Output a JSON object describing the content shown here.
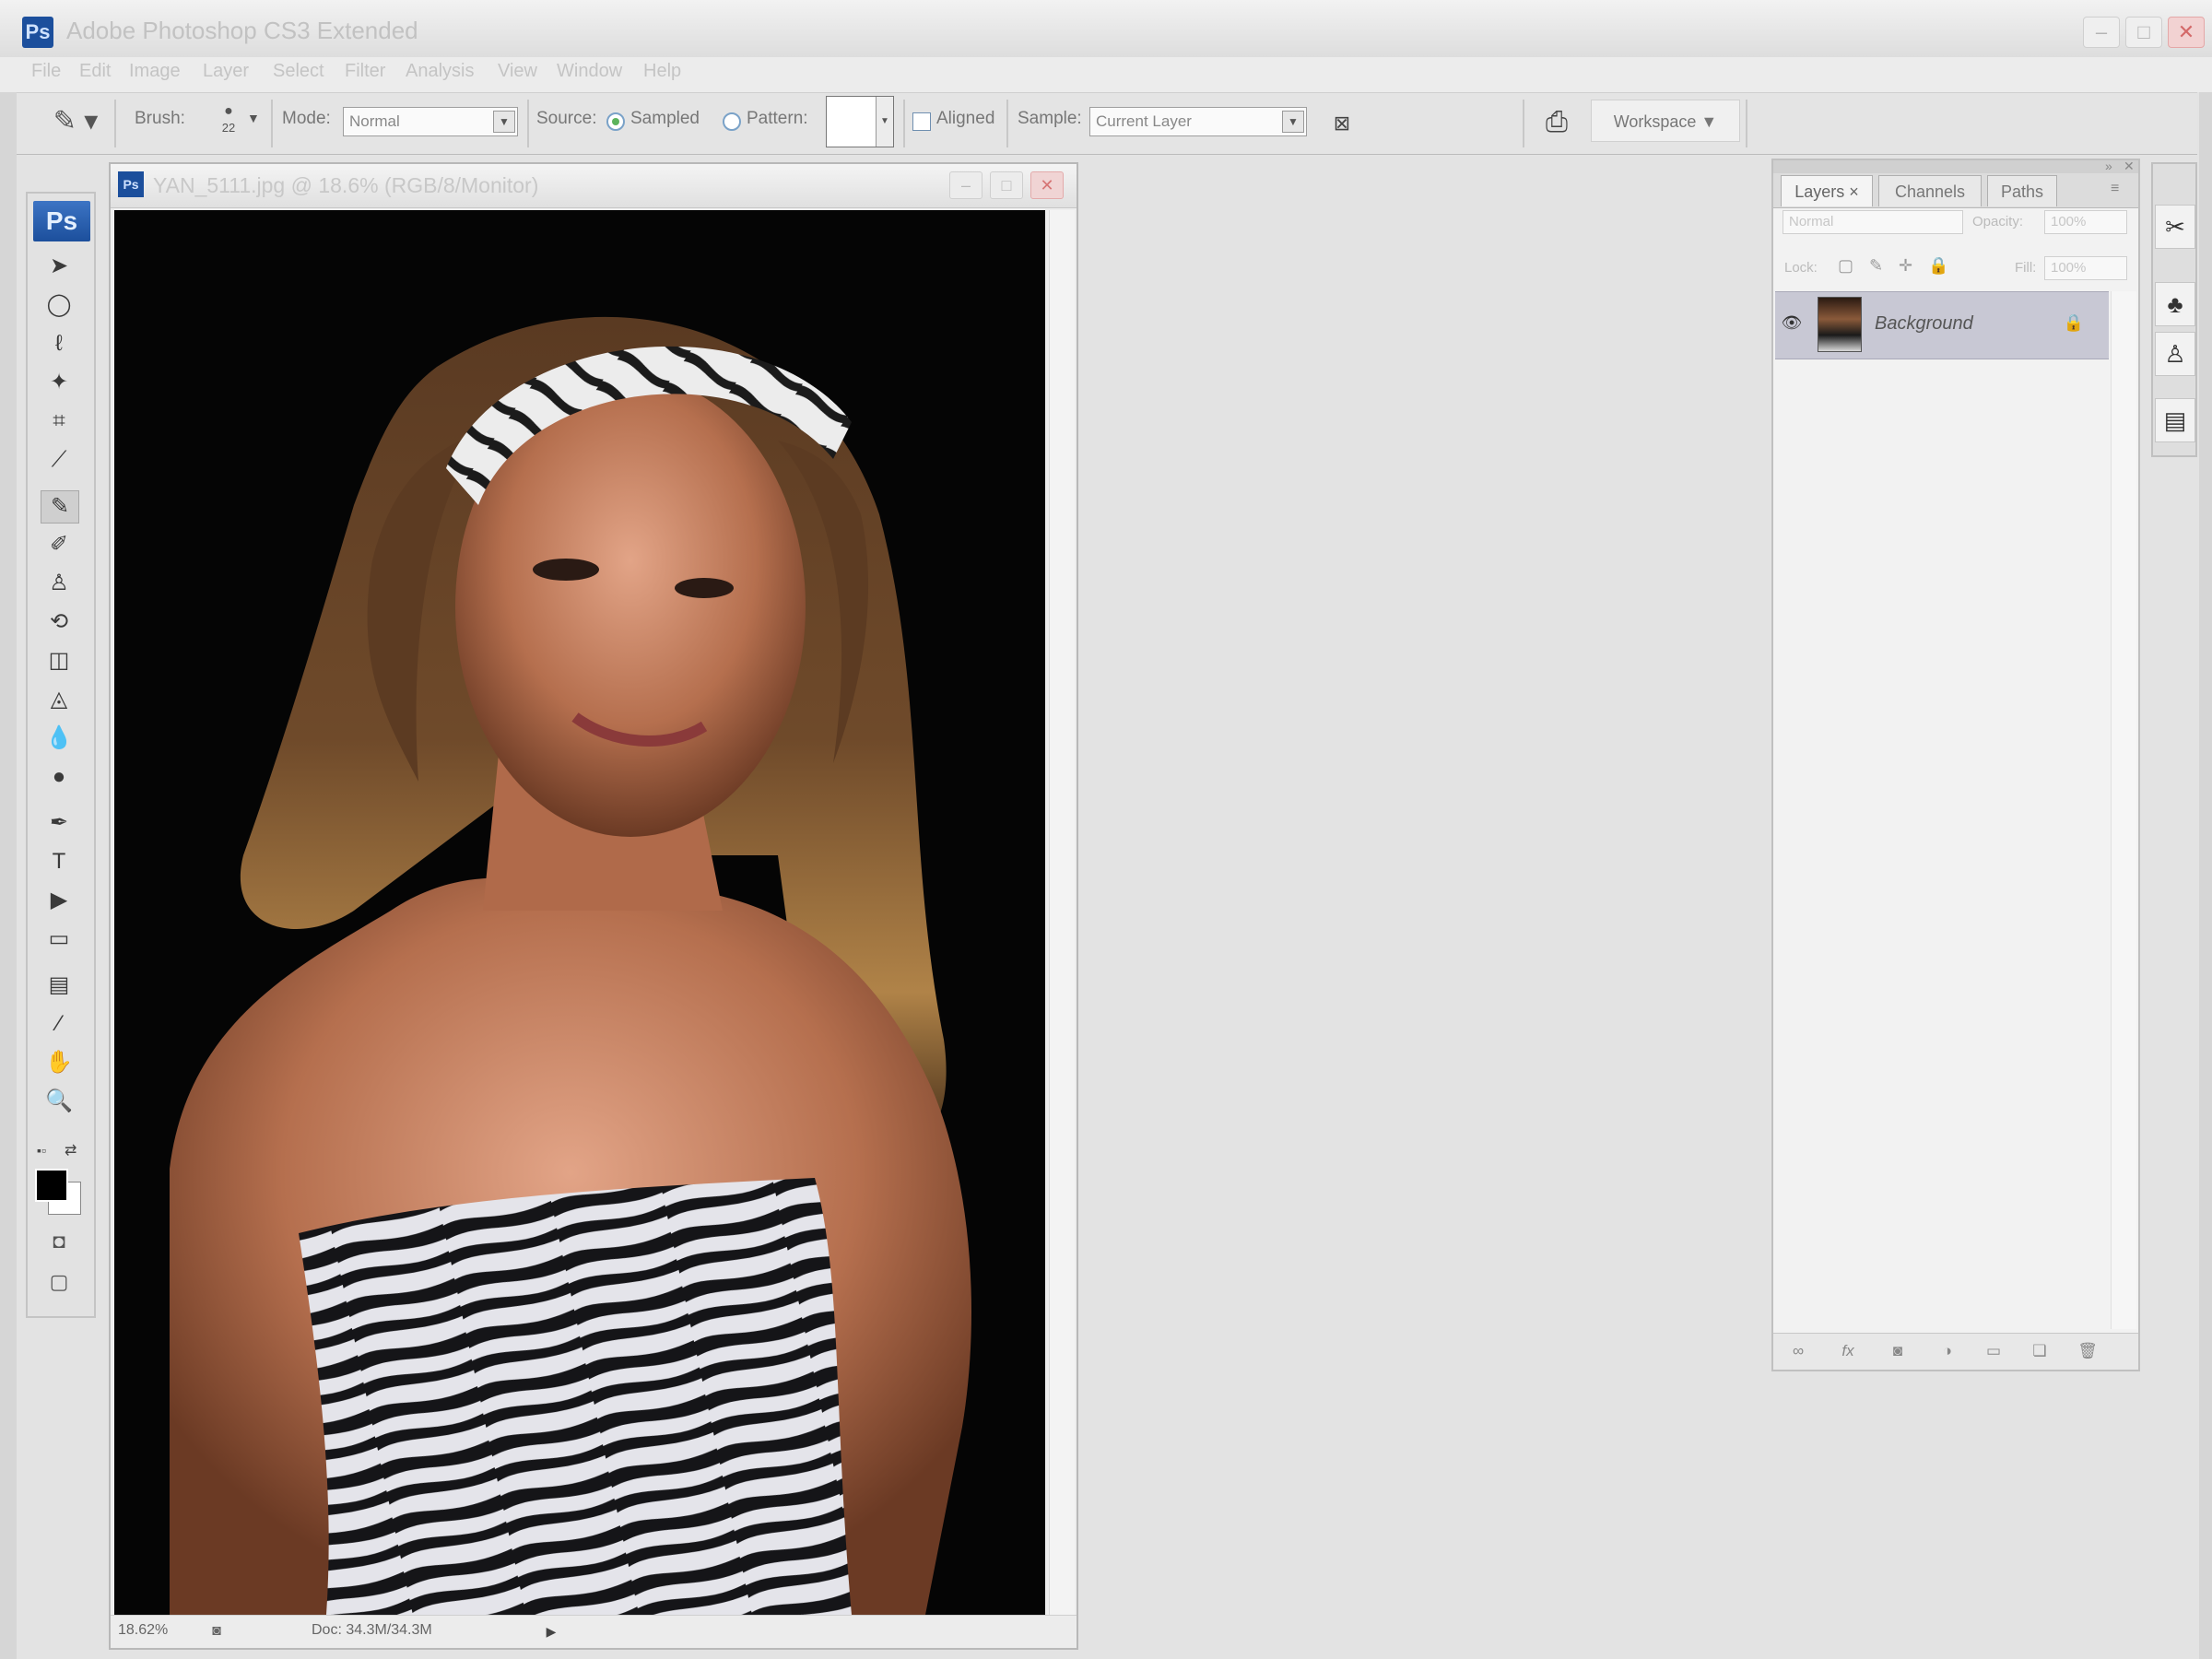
{
  "app": {
    "title": "Adobe Photoshop CS3 Extended",
    "icon_label": "Ps",
    "window_buttons": {
      "minimize": "–",
      "maximize": "□",
      "close": "✕"
    }
  },
  "menu": [
    "File",
    "Edit",
    "Image",
    "Layer",
    "Select",
    "Filter",
    "Analysis",
    "View",
    "Window",
    "Help"
  ],
  "options_bar": {
    "brush_label": "Brush:",
    "brush_size": "22",
    "mode_label": "Mode:",
    "mode_value": "Normal",
    "source_label": "Source:",
    "source_sampled": "Sampled",
    "source_pattern": "Pattern:",
    "aligned_label": "Aligned",
    "sample_label": "Sample:",
    "sample_value": "Current Layer",
    "workspace_label": "Workspace ▼"
  },
  "toolbox": {
    "logo": "Ps",
    "tools": [
      {
        "name": "move-tool",
        "glyph": "➤"
      },
      {
        "name": "marquee-tool",
        "glyph": "◯"
      },
      {
        "name": "lasso-tool",
        "glyph": "ℓ"
      },
      {
        "name": "magic-wand-tool",
        "glyph": "✦"
      },
      {
        "name": "crop-tool",
        "glyph": "⌗"
      },
      {
        "name": "slice-tool",
        "glyph": "⟋"
      },
      {
        "name": "healing-brush-tool",
        "glyph": "✎",
        "active": true
      },
      {
        "name": "brush-tool",
        "glyph": "✐"
      },
      {
        "name": "clone-stamp-tool",
        "glyph": "♙"
      },
      {
        "name": "history-brush-tool",
        "glyph": "⟲"
      },
      {
        "name": "eraser-tool",
        "glyph": "◫"
      },
      {
        "name": "paint-bucket-tool",
        "glyph": "◬"
      },
      {
        "name": "blur-tool",
        "glyph": "💧"
      },
      {
        "name": "dodge-tool",
        "glyph": "●"
      },
      {
        "name": "pen-tool",
        "glyph": "✒"
      },
      {
        "name": "type-tool",
        "glyph": "T"
      },
      {
        "name": "path-selection-tool",
        "glyph": "▶"
      },
      {
        "name": "shape-tool",
        "glyph": "▭"
      },
      {
        "name": "notes-tool",
        "glyph": "▤"
      },
      {
        "name": "eyedropper-tool",
        "glyph": "⁄"
      },
      {
        "name": "hand-tool",
        "glyph": "✋"
      },
      {
        "name": "zoom-tool",
        "glyph": "🔍"
      }
    ]
  },
  "document": {
    "title": "YAN_5111.jpg @ 18.6% (RGB/8/Monitor)",
    "icon_label": "Ps",
    "zoom": "18.62%",
    "doc_info": "Doc: 34.3M/34.3M"
  },
  "layers_panel": {
    "tabs": [
      "Layers ×",
      "Channels",
      "Paths"
    ],
    "blend_mode": "Normal",
    "opacity_label": "Opacity:",
    "opacity_value": "100%",
    "lock_label": "Lock:",
    "fill_label": "Fill:",
    "fill_value": "100%",
    "layers": [
      {
        "name": "Background",
        "visible": true,
        "locked": true
      }
    ],
    "footer_icons": [
      "link-layers",
      "fx",
      "add-mask",
      "adjustment-layer",
      "new-group",
      "new-layer",
      "delete-layer"
    ]
  },
  "colors": {
    "workspace_bg": "#7d7d7d",
    "selected_layer": "#c8c8d4",
    "ps_blue": "#1c4f9c"
  }
}
